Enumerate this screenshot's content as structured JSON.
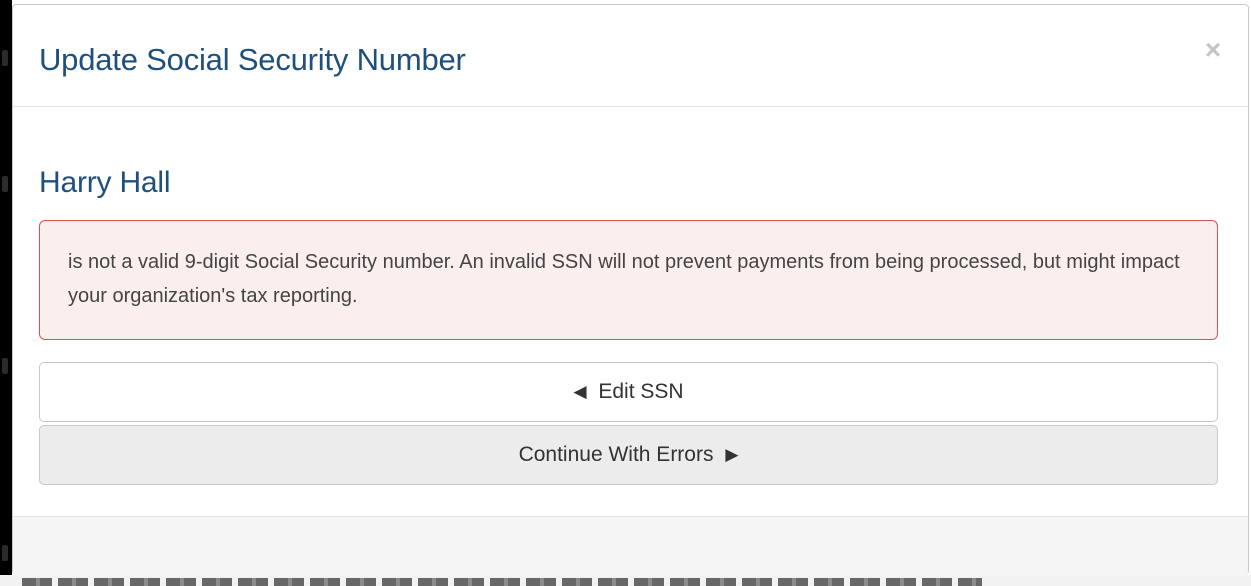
{
  "modal": {
    "title": "Update Social Security Number",
    "close_symbol": "×",
    "close_icon": "close-icon"
  },
  "person": {
    "name": "Harry Hall"
  },
  "alert": {
    "message": "is not a valid 9-digit Social Security number. An invalid SSN will not prevent payments from being processed, but might impact your organization's tax reporting.",
    "border_color": "#d9534f",
    "background_color": "#fbefee"
  },
  "buttons": {
    "edit": {
      "icon": "triangle-left-icon",
      "glyph": "◀",
      "label": "Edit SSN"
    },
    "continue": {
      "icon": "triangle-right-icon",
      "glyph": "▶",
      "label": "Continue With Errors"
    }
  },
  "colors": {
    "heading": "#1f4f7b",
    "close": "#c4c4c4"
  }
}
